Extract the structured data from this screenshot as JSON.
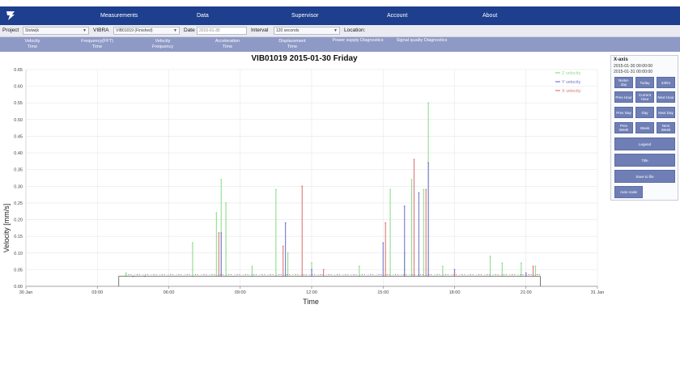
{
  "nav": {
    "items": [
      "Measurements",
      "Data",
      "Supervisor",
      "Account",
      "About"
    ]
  },
  "filters": {
    "project_label": "Project",
    "project_value": "Stolwijk",
    "vibra_label": "VIBRA",
    "vibra_value": "VIB01019 (Finished)",
    "date_label": "Date",
    "date_value": "2015-01-30",
    "interval_label": "Interval",
    "interval_value": "120 seconds",
    "location_label": "Location:"
  },
  "tabs": [
    "Velocity\nTime",
    "Frequency(FFT)\nTime",
    "Velocity\nFrequency",
    "Acceleration\nTime",
    "Displacement\nTime",
    "Power supply Diagnostics",
    "Signal quality Diagnostics"
  ],
  "chart_data": {
    "type": "line",
    "title": "VIB01019 2015-01-30 Friday",
    "xlabel": "Time",
    "ylabel": "Velocity [mm/s]",
    "ylim": [
      0,
      0.65
    ],
    "yticks": [
      "0.00",
      "0.05",
      "0.10",
      "0.15",
      "0.20",
      "0.25",
      "0.30",
      "0.35",
      "0.40",
      "0.45",
      "0.50",
      "0.55",
      "0.60",
      "0.65"
    ],
    "xticks": [
      "30 Jan",
      "03:00",
      "06:00",
      "09:00",
      "12:00",
      "15:00",
      "18:00",
      "21:00",
      "31 Jan"
    ],
    "xlim_hours": [
      0,
      24
    ],
    "grid": true,
    "legend_position": "top-right",
    "series": [
      {
        "name": "Z velocity",
        "color": "#8fdc8f",
        "points": [
          [
            4.2,
            0.04
          ],
          [
            7.0,
            0.13
          ],
          [
            8.0,
            0.22
          ],
          [
            8.2,
            0.32
          ],
          [
            8.4,
            0.25
          ],
          [
            9.5,
            0.06
          ],
          [
            10.5,
            0.29
          ],
          [
            11.0,
            0.1
          ],
          [
            12.0,
            0.07
          ],
          [
            14.0,
            0.06
          ],
          [
            15.3,
            0.29
          ],
          [
            15.9,
            0.1
          ],
          [
            16.2,
            0.32
          ],
          [
            16.7,
            0.29
          ],
          [
            16.9,
            0.55
          ],
          [
            17.5,
            0.06
          ],
          [
            19.5,
            0.09
          ],
          [
            20.0,
            0.07
          ],
          [
            20.8,
            0.07
          ],
          [
            21.4,
            0.06
          ]
        ]
      },
      {
        "name": "Y velocity",
        "color": "#7777cc",
        "points": [
          [
            4.5,
            0.03
          ],
          [
            8.2,
            0.16
          ],
          [
            10.9,
            0.19
          ],
          [
            12.0,
            0.05
          ],
          [
            15.0,
            0.13
          ],
          [
            15.9,
            0.24
          ],
          [
            16.5,
            0.28
          ],
          [
            16.9,
            0.37
          ],
          [
            18.0,
            0.05
          ],
          [
            21.0,
            0.04
          ]
        ]
      },
      {
        "name": "X velocity",
        "color": "#dd7777",
        "points": [
          [
            5.0,
            0.03
          ],
          [
            8.1,
            0.16
          ],
          [
            10.8,
            0.12
          ],
          [
            11.6,
            0.3
          ],
          [
            12.5,
            0.05
          ],
          [
            15.1,
            0.19
          ],
          [
            16.3,
            0.38
          ],
          [
            16.8,
            0.29
          ],
          [
            18.0,
            0.04
          ],
          [
            21.3,
            0.06
          ]
        ]
      },
      {
        "name": "",
        "color": "#555555",
        "points": [
          [
            3.9,
            0.03
          ],
          [
            21.6,
            0.03
          ]
        ]
      }
    ]
  },
  "panel": {
    "xaxis_title": "X-axis",
    "xaxis_from": "2015-01-30 00:00:00",
    "xaxis_to": "2015-01-31 00:00:00",
    "buttons": {
      "yesterday": "Yester-\nday",
      "today": "Today",
      "hours24": "24hrs",
      "prev_hour": "Prev Hour",
      "current_hour": "Current\nHour",
      "next_hour": "Next Hour",
      "prev_day": "Prev Day",
      "day": "Day",
      "next_day": "Next Day",
      "prev_week": "Prev\nWeek",
      "week": "Week",
      "next_week": "Next\nWeek",
      "legend": "Legend",
      "title": "Title",
      "save_to_file": "Save to file",
      "auto_scale": "Auto scale"
    }
  }
}
